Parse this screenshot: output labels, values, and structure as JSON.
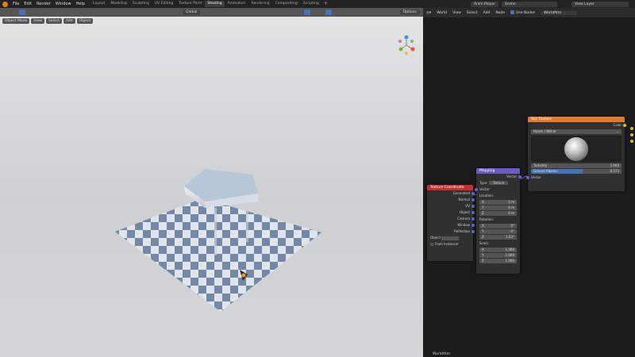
{
  "topbar": {
    "menu": [
      "File",
      "Edit",
      "Render",
      "Window",
      "Help"
    ],
    "workspaces": [
      "Layout",
      "Modeling",
      "Sculpting",
      "UV Editing",
      "Texture Paint",
      "Shading",
      "Animation",
      "Rendering",
      "Compositing",
      "Scripting"
    ],
    "active_workspace": "Shading",
    "plus": "+",
    "anim_player": "Anim Player",
    "scene": "Scene",
    "view_layer": "View Layer"
  },
  "viewport": {
    "mode": "Object Mode",
    "view": "View",
    "select": "Select",
    "add": "Add",
    "object": "Object",
    "transform": "Global",
    "options": "Options"
  },
  "node_editor": {
    "world": "World",
    "view": "View",
    "select": "Select",
    "add": "Add",
    "node": "Node",
    "use_nodes": "Use Nodes",
    "world_name": "WorldAtm",
    "footer": "WorldAtm"
  },
  "tex_coord": {
    "title": "Texture Coordinate",
    "outputs": [
      "Generated",
      "Normal",
      "UV",
      "Object",
      "Camera",
      "Window",
      "Reflection"
    ],
    "object_label": "Object",
    "from_instancer": "From Instancer",
    "color": "#c13333"
  },
  "mapping": {
    "title": "Mapping",
    "out": "Vector",
    "type_label": "Type:",
    "type_value": "Texture",
    "vector": "Vector",
    "location_label": "Location:",
    "location": [
      {
        "k": "X",
        "v": "0 m"
      },
      {
        "k": "Y",
        "v": "0 m"
      },
      {
        "k": "Z",
        "v": "0 m"
      }
    ],
    "rotation_label": "Rotation:",
    "rotation": [
      {
        "k": "X",
        "v": "0°"
      },
      {
        "k": "Y",
        "v": "0°"
      },
      {
        "k": "Z",
        "v": "1.63°"
      }
    ],
    "scale_label": "Scale:",
    "scale": [
      {
        "k": "X",
        "v": "1.000"
      },
      {
        "k": "Y",
        "v": "1.000"
      },
      {
        "k": "Z",
        "v": "1.000"
      }
    ],
    "color": "#6b5cc0"
  },
  "sky": {
    "title": "Sky Texture",
    "out": "Color",
    "model": "Hosek / Wilkie",
    "turbidity_label": "Turbidity",
    "turbidity": "5.000",
    "albedo_label": "Ground Albedo",
    "albedo": "0.573",
    "albedo_fraction": 0.573,
    "vector": "Vector",
    "color": "#e07b2e"
  }
}
